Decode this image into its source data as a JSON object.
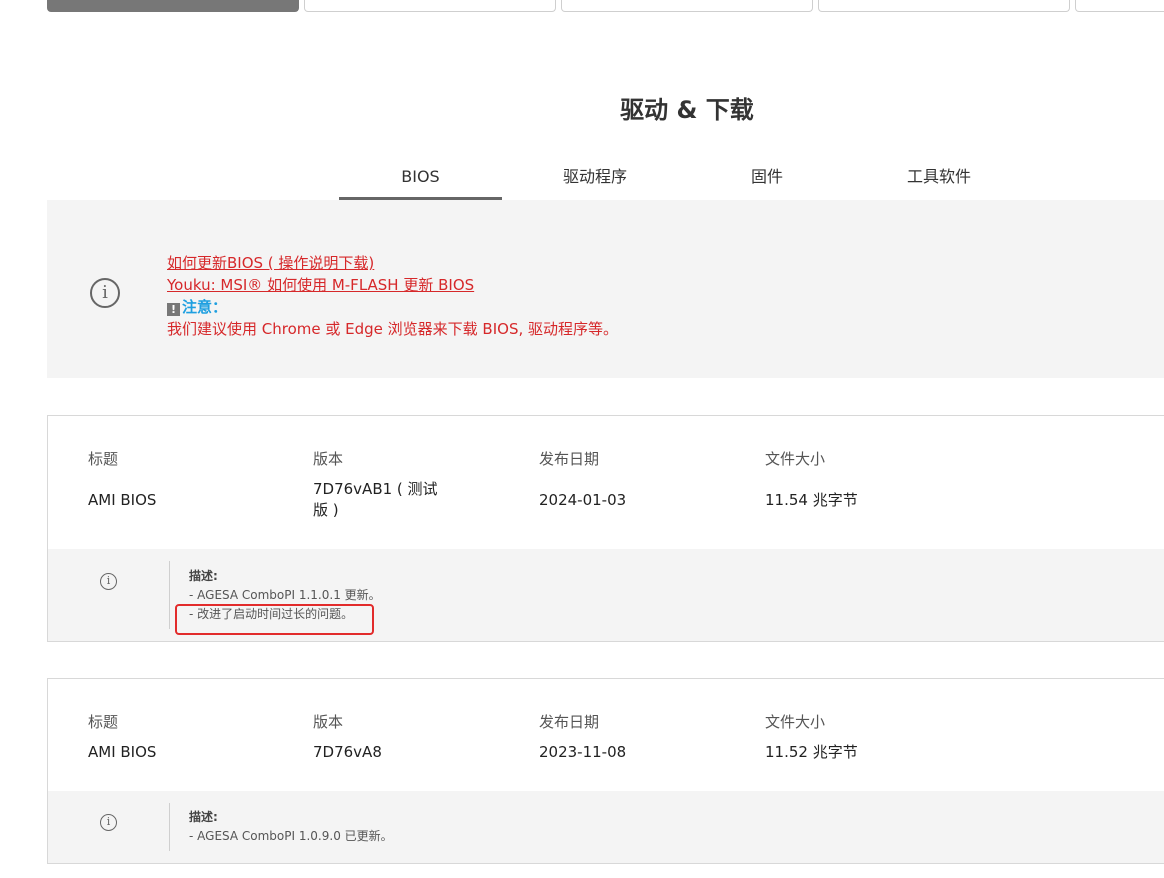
{
  "page_title": "驱动 & 下载",
  "tabs": [
    {
      "label": "BIOS"
    },
    {
      "label": "驱动程序"
    },
    {
      "label": "固件"
    },
    {
      "label": "工具软件"
    }
  ],
  "notice": {
    "line1": "如何更新BIOS ( 操作说明下载)",
    "line2": "Youku: MSI® 如何使用 M-FLASH 更新 BIOS",
    "warn_mark": "!",
    "warn_label": "注意：",
    "line4": "我们建议使用 Chrome 或 Edge 浏览器来下载 BIOS, 驱动程序等。"
  },
  "column_headers": {
    "title": "标题",
    "version": "版本",
    "date": "发布日期",
    "size": "文件大小"
  },
  "entries": [
    {
      "title": "AMI BIOS",
      "version": "7D76vAB1 ( 测试版 )",
      "date": "2024-01-03",
      "size": "11.54 兆字节",
      "desc_label": "描述:",
      "desc_lines": [
        "- AGESA ComboPI 1.1.0.1 更新。",
        "- 改进了启动时间过长的问题。"
      ]
    },
    {
      "title": "AMI BIOS",
      "version": "7D76vA8",
      "date": "2023-11-08",
      "size": "11.52 兆字节",
      "desc_label": "描述:",
      "desc_lines": [
        "- AGESA ComboPI 1.0.9.0 已更新。"
      ]
    }
  ],
  "colors": {
    "accent_red": "#d6282a",
    "notice_blue": "#1e9fe0",
    "highlight_box": "#e22b2b"
  }
}
